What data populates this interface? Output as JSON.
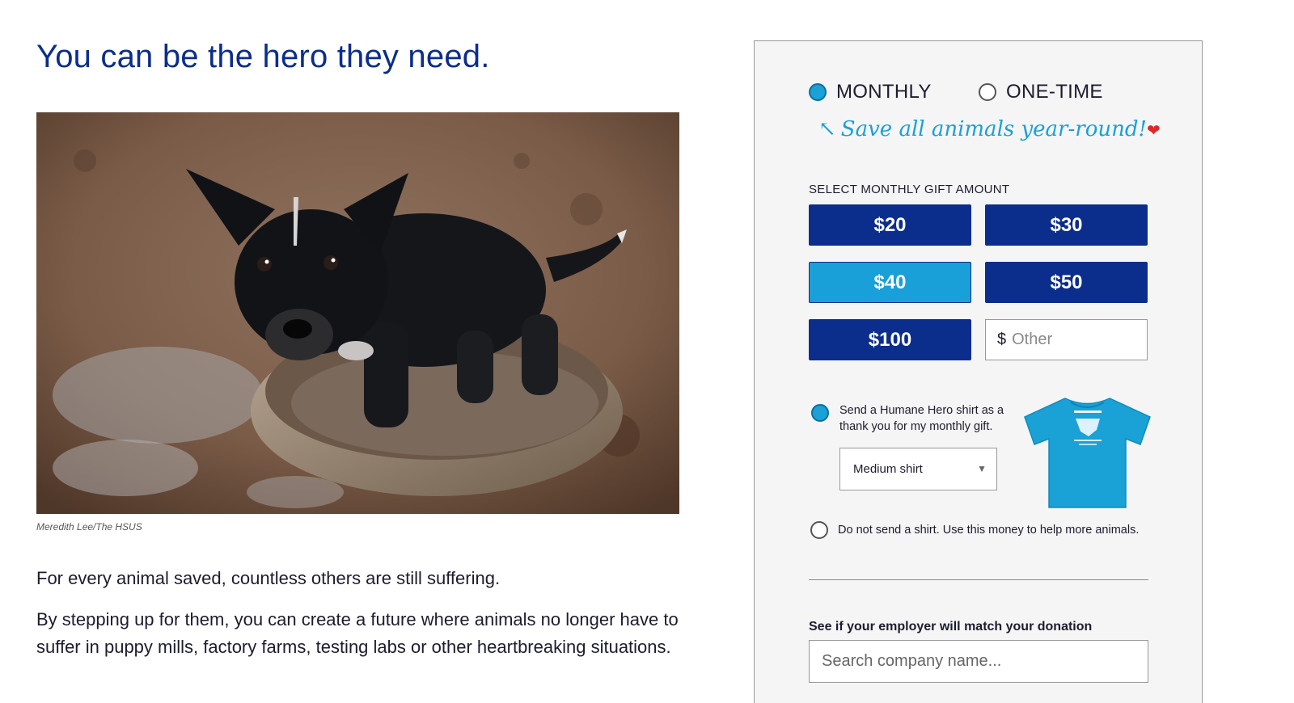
{
  "headline": "You can be the hero they need.",
  "photo": {
    "description_icon": "puppy-photo",
    "credit": "Meredith Lee/The HSUS"
  },
  "body": {
    "para1": "For every animal saved, countless others are still suffering.",
    "para2": "By stepping up for them, you can create a future where animals no longer have to suffer in puppy mills, factory farms, testing labs or other heartbreaking situations."
  },
  "donation": {
    "frequency": {
      "monthly_label": "MONTHLY",
      "onetime_label": "ONE-TIME",
      "selected": "MONTHLY"
    },
    "tagline": "Save all animals year-round!",
    "gift_title": "SELECT MONTHLY GIFT AMOUNT",
    "amounts": [
      "$20",
      "$30",
      "$40",
      "$50",
      "$100"
    ],
    "selected_amount": "$40",
    "other": {
      "currency": "$",
      "placeholder": "Other"
    },
    "shirt_option": {
      "label": "Send a Humane Hero shirt as a thank you for my monthly gift.",
      "size_selected": "Medium shirt",
      "shirt_color": "#1aa1d6"
    },
    "no_shirt_label": "Do not send a shirt. Use this money to help more animals.",
    "employer": {
      "title": "See if your employer will match your donation",
      "placeholder": "Search company name..."
    }
  },
  "colors": {
    "brand_navy": "#0b2d8c",
    "accent_blue": "#19a0d8",
    "heart_red": "#e02828"
  }
}
